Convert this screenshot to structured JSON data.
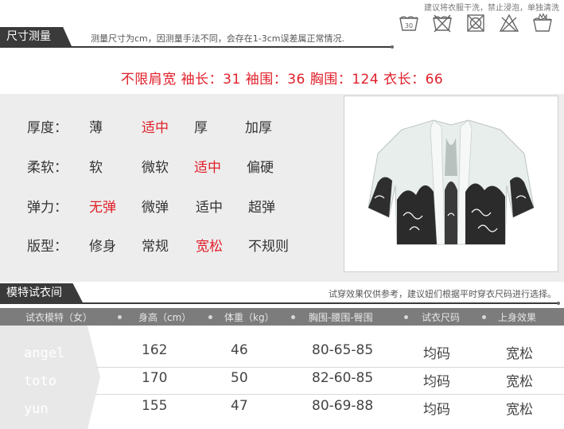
{
  "care": {
    "note": "建议将衣服干洗，禁止浸泡，单独清洗",
    "icons": [
      "wash-30-icon",
      "no-bleach-icon",
      "no-tumble-dry-icon",
      "no-chlorine-icon",
      "hand-wash-icon"
    ],
    "wash_temp": "30"
  },
  "size_section": {
    "title": "尺寸测量",
    "note": "测量尺寸为cm，因测量手法不同，会存在1-3cm误差属正常情况.",
    "size_line": "不限肩宽 袖长：31 袖围：36 胸围：124 衣长：66"
  },
  "attributes": [
    {
      "label": "厚度：",
      "options": [
        "薄",
        "适中",
        "厚",
        "加厚"
      ],
      "selected": 1
    },
    {
      "label": "柔软：",
      "options": [
        "软",
        "微软",
        "适中",
        "偏硬"
      ],
      "selected": 2
    },
    {
      "label": "弹力：",
      "options": [
        "无弹",
        "微弹",
        "适中",
        "超弹"
      ],
      "selected": 0
    },
    {
      "label": "版型：",
      "options": [
        "修身",
        "常规",
        "宽松",
        "不规则"
      ],
      "selected": 2
    }
  ],
  "model_section": {
    "title": "模特试衣间",
    "note": "试穿效果仅供参考，建议妞们根据平时穿衣尺码进行选择。",
    "headers": [
      "试衣模特（女）",
      "身高（cm）",
      "体重（kg）",
      "胸围-腰围-臀围",
      "试衣尺码",
      "上身效果"
    ],
    "rows": [
      {
        "name": "angel",
        "height": "162",
        "weight": "46",
        "bwh": "80-65-85",
        "size": "均码",
        "effect": "宽松"
      },
      {
        "name": "toto",
        "height": "170",
        "weight": "50",
        "bwh": "82-60-85",
        "size": "均码",
        "effect": "宽松"
      },
      {
        "name": "yun",
        "height": "155",
        "weight": "47",
        "bwh": "80-69-88",
        "size": "均码",
        "effect": "宽松"
      }
    ]
  },
  "colors": {
    "accent_red": "#e0202a",
    "dark_tab": "#3a3a3a",
    "panel_gray": "#ededed",
    "table_head": "#7c7c7c"
  }
}
